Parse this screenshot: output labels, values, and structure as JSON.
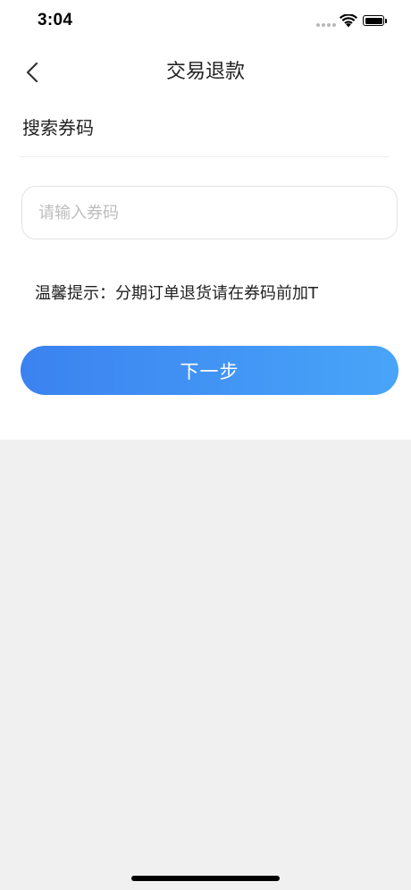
{
  "status_bar": {
    "time": "3:04"
  },
  "nav": {
    "title": "交易退款",
    "back_icon": "chevron-left-icon"
  },
  "section": {
    "label": "搜索券码"
  },
  "input": {
    "value": "",
    "placeholder": "请输入券码"
  },
  "tip": {
    "text": "温馨提示：分期订单退货请在券码前加T"
  },
  "next_button": {
    "label": "下一步",
    "gradient_start": "#3b82f0",
    "gradient_end": "#48a5f8"
  },
  "colors": {
    "page_background": "#f0f0f0",
    "card_background": "#ffffff",
    "text_primary": "#222222",
    "placeholder": "#bdbdbd"
  }
}
